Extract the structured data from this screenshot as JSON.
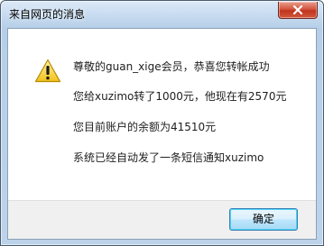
{
  "dialog": {
    "title": "来自网页的消息",
    "messages": [
      "尊敬的guan_xige会员，恭喜您转帐成功",
      "您给xuzimo转了1000元，他现在有2570元",
      "您目前账户的余额为41510元",
      "系统已经自动发了一条短信通知xuzimo"
    ],
    "ok_label": "确定",
    "icons": {
      "close": "close-icon",
      "warning": "warning-icon"
    }
  }
}
